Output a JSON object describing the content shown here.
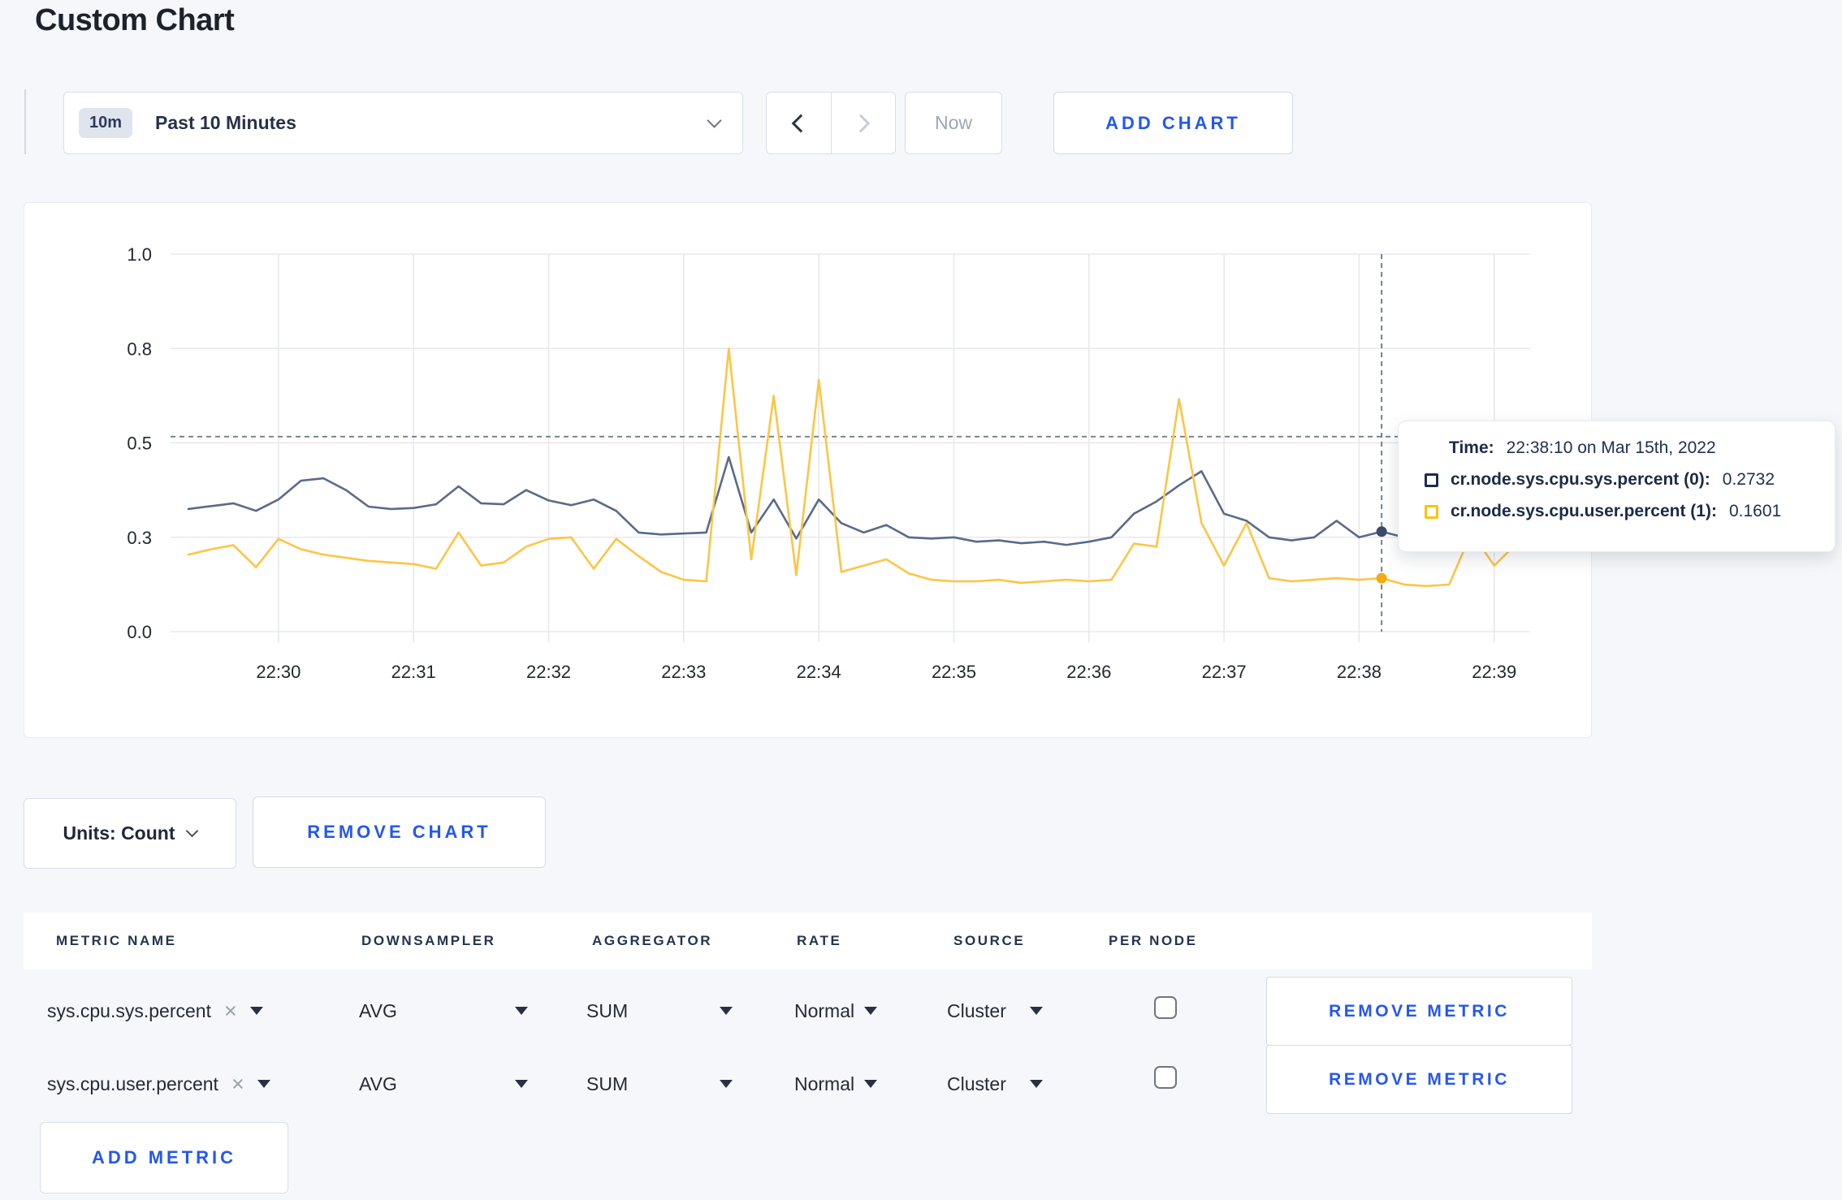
{
  "page": {
    "title": "Custom Chart",
    "background": "#f6f7fa",
    "accent_blue": "#2457f0"
  },
  "toolbar": {
    "time_window_badge": "10m",
    "time_window_label": "Past 10 Minutes",
    "now_label": "Now",
    "add_chart_label": "ADD CHART"
  },
  "icons": {
    "close": "×",
    "chevron_down": "css-chevron",
    "chevron_left": "css-chevron",
    "chevron_right": "css-chevron",
    "caret_down": "css-triangle"
  },
  "chart_data": {
    "type": "line",
    "title": "",
    "xlabel": "",
    "ylabel": "",
    "grid": true,
    "legend_position": "tooltip-overlay",
    "y_ticks": [
      0,
      0.3,
      0.5,
      0.8,
      1.0
    ],
    "y_tick_labels": [
      "0.0",
      "0.3",
      "0.5",
      "0.8",
      "1.0"
    ],
    "x_tick_labels": [
      "22:30",
      "22:31",
      "22:32",
      "22:33",
      "22:34",
      "22:35",
      "22:36",
      "22:37",
      "22:38",
      "22:39"
    ],
    "x_start": "22:29:20",
    "x_step_seconds": 10,
    "crosshair": {
      "time": "22:38:10",
      "x_index": 53,
      "hline_value": 0.52
    },
    "series": [
      {
        "name": "cr.node.sys.cpu.sys.percent",
        "color": "#5a6a89",
        "dot_color": "#3d4a68",
        "values": [
          0.36,
          0.366,
          0.372,
          0.356,
          0.38,
          0.42,
          0.425,
          0.4,
          0.365,
          0.36,
          0.362,
          0.37,
          0.408,
          0.372,
          0.37,
          0.4,
          0.378,
          0.368,
          0.38,
          0.356,
          0.31,
          0.306,
          0.308,
          0.31,
          0.47,
          0.31,
          0.38,
          0.296,
          0.38,
          0.33,
          0.31,
          0.326,
          0.3,
          0.296,
          0.3,
          0.286,
          0.29,
          0.281,
          0.286,
          0.276,
          0.286,
          0.3,
          0.35,
          0.376,
          0.41,
          0.44,
          0.35,
          0.335,
          0.3,
          0.29,
          0.3,
          0.335,
          0.3,
          0.312,
          0.3,
          0.296,
          0.3,
          0.306,
          0.296,
          0.306
        ]
      },
      {
        "name": "cr.node.sys.cpu.user.percent",
        "color": "#fdc545",
        "dot_color": "#f5ab13",
        "values": [
          0.245,
          0.262,
          0.275,
          0.205,
          0.295,
          0.262,
          0.245,
          0.235,
          0.225,
          0.22,
          0.215,
          0.2,
          0.31,
          0.21,
          0.22,
          0.27,
          0.295,
          0.3,
          0.2,
          0.295,
          0.24,
          0.19,
          0.165,
          0.16,
          0.8,
          0.23,
          0.65,
          0.18,
          0.7,
          0.19,
          0.21,
          0.23,
          0.185,
          0.165,
          0.16,
          0.16,
          0.165,
          0.155,
          0.16,
          0.165,
          0.16,
          0.165,
          0.28,
          0.27,
          0.64,
          0.33,
          0.21,
          0.33,
          0.17,
          0.16,
          0.165,
          0.17,
          0.165,
          0.17,
          0.15,
          0.145,
          0.15,
          0.31,
          0.21,
          0.28
        ]
      }
    ]
  },
  "tooltip": {
    "time_label": "Time:",
    "time_value": "22:38:10 on Mar 15th, 2022",
    "series": [
      {
        "swatch_color": "#1d2c4f",
        "name": "cr.node.sys.cpu.sys.percent (0):",
        "value": "0.2732"
      },
      {
        "swatch_color": "#fec20d",
        "name": "cr.node.sys.cpu.user.percent (1):",
        "value": "0.1601"
      }
    ]
  },
  "chart_controls": {
    "units_label": "Units: Count",
    "remove_chart_label": "REMOVE CHART"
  },
  "metrics_table": {
    "headers": [
      "METRIC NAME",
      "DOWNSAMPLER",
      "AGGREGATOR",
      "RATE",
      "SOURCE",
      "PER NODE"
    ],
    "rows": [
      {
        "metric_name": "sys.cpu.sys.percent",
        "downsampler": "AVG",
        "aggregator": "SUM",
        "rate": "Normal",
        "source": "Cluster",
        "per_node_checked": false,
        "remove_label": "REMOVE METRIC"
      },
      {
        "metric_name": "sys.cpu.user.percent",
        "downsampler": "AVG",
        "aggregator": "SUM",
        "rate": "Normal",
        "source": "Cluster",
        "per_node_checked": false,
        "remove_label": "REMOVE METRIC"
      }
    ],
    "add_metric_label": "ADD METRIC"
  }
}
